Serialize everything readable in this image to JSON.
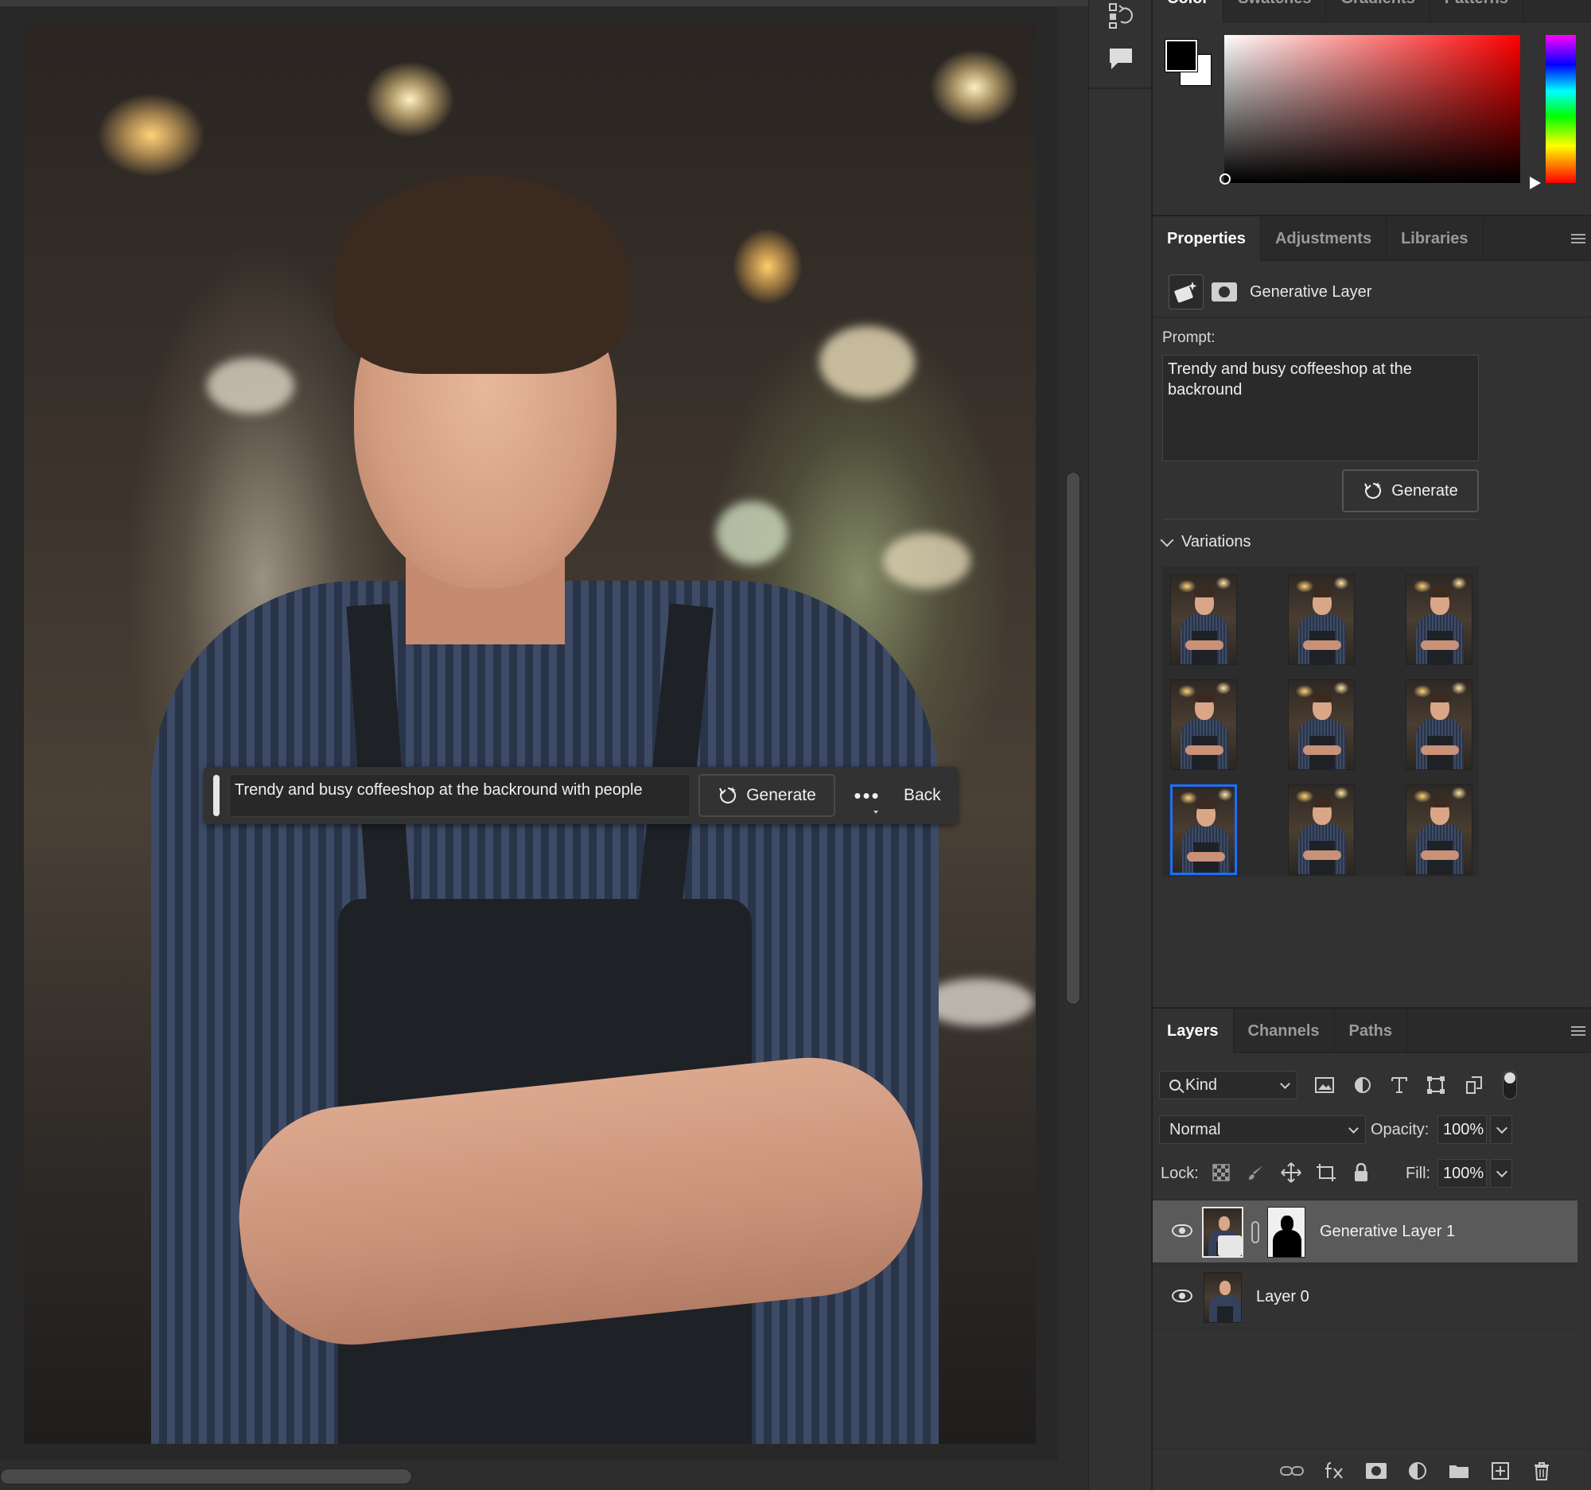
{
  "canvas": {
    "taskbar": {
      "prompt": "Trendy and busy coffeeshop at the backround with people",
      "generate_label": "Generate",
      "more_label": "•••",
      "back_label": "Back"
    }
  },
  "color_panel": {
    "tabs": [
      "Color",
      "Swatches",
      "Gradients",
      "Patterns"
    ],
    "foreground": "#000000",
    "background": "#ffffff"
  },
  "properties_panel": {
    "tabs": [
      "Properties",
      "Adjustments",
      "Libraries"
    ],
    "title": "Generative Layer",
    "prompt_label": "Prompt:",
    "prompt_text": "Trendy and busy coffeeshop at the backround",
    "generate_label": "Generate",
    "variations_label": "Variations",
    "variation_count": 9,
    "selected_variation": 7
  },
  "layers_panel": {
    "tabs": [
      "Layers",
      "Channels",
      "Paths"
    ],
    "filter_kind": "Kind",
    "blend_mode": "Normal",
    "opacity_label": "Opacity:",
    "opacity_value": "100%",
    "lock_label": "Lock:",
    "fill_label": "Fill:",
    "fill_value": "100%",
    "layers": [
      {
        "name": "Generative Layer 1",
        "selected": true,
        "visible": true
      },
      {
        "name": "Layer 0",
        "selected": false,
        "visible": true
      }
    ],
    "footer_icons": [
      "link-icon",
      "fx-icon",
      "mask-icon",
      "adjustment-icon",
      "folder-icon",
      "new-layer-icon",
      "trash-icon"
    ]
  },
  "colors": {
    "accent_selection": "#1e6fff",
    "panel_bg": "#323232",
    "selected_row": "#5a5a5a"
  }
}
